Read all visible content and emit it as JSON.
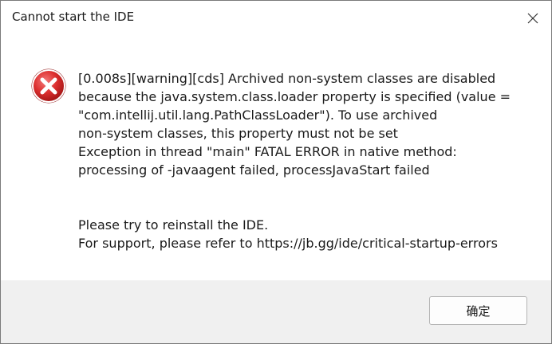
{
  "window": {
    "title": "Cannot start the IDE"
  },
  "icons": {
    "close": "close-icon",
    "error": "error-icon"
  },
  "message": {
    "lines": [
      "[0.008s][warning][cds] Archived non-system classes are disabled",
      "because the java.system.class.loader property is specified (value =",
      "\"com.intellij.util.lang.PathClassLoader\"). To use archived",
      "non-system classes, this property must not be set",
      "Exception in thread \"main\" FATAL ERROR in native method:",
      "processing of -javaagent failed, processJavaStart failed"
    ],
    "help_lines": [
      "Please try to reinstall the IDE.",
      "For support, please refer to https://jb.gg/ide/critical-startup-errors"
    ]
  },
  "footer": {
    "ok_label": "确定"
  },
  "colors": {
    "error_red": "#d9262b",
    "dialog_bg": "#ffffff",
    "footer_bg": "#f0f0f0"
  }
}
